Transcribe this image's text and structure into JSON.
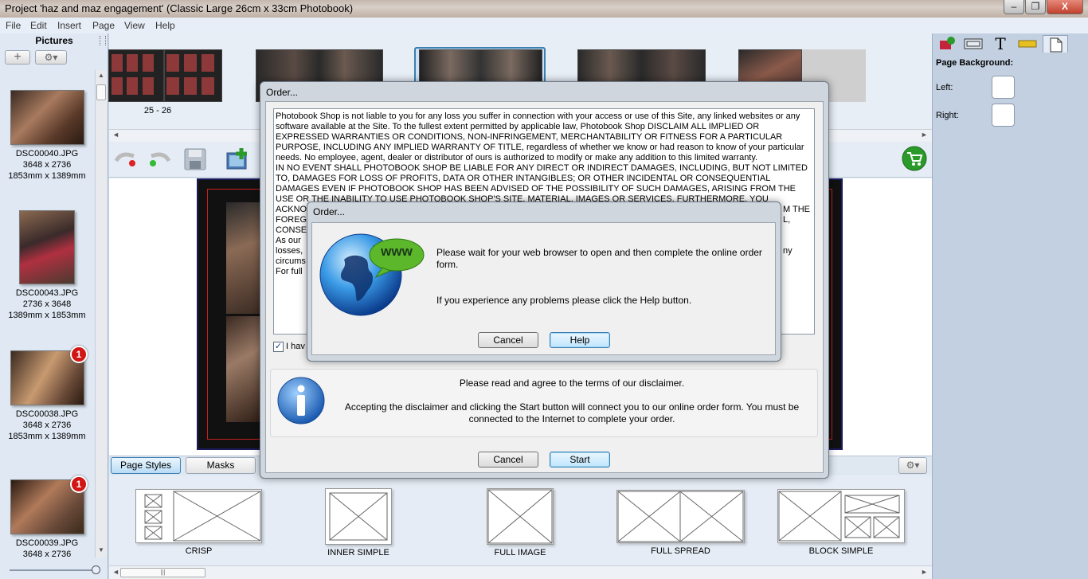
{
  "window": {
    "title": "Project 'haz and maz engagement' (Classic Large 26cm x 33cm Photobook)",
    "minimize": "–",
    "maximize": "❐",
    "close": "X"
  },
  "menu": [
    "File",
    "Edit",
    "Insert",
    "Page",
    "View",
    "Help"
  ],
  "left_panel": {
    "heading": "Pictures",
    "add_icon": "+",
    "gear_icon": "⚙▾",
    "pictures": [
      {
        "name": "DSC00040.JPG",
        "pixels": "3648 x 2736",
        "size": "1853mm x 1389mm",
        "badge": ""
      },
      {
        "name": "DSC00043.JPG",
        "pixels": "2736 x 3648",
        "size": "1389mm x 1853mm",
        "badge": ""
      },
      {
        "name": "DSC00038.JPG",
        "pixels": "3648 x 2736",
        "size": "1853mm x 1389mm",
        "badge": "1"
      },
      {
        "name": "DSC00039.JPG",
        "pixels": "3648 x 2736",
        "size": "",
        "badge": "1"
      }
    ]
  },
  "filmstrip": {
    "page_range_label": "25 - 26"
  },
  "toolbar": {
    "undo_icon": "undo-icon",
    "redo_icon": "redo-icon",
    "save_icon": "save-icon",
    "add_page_icon": "add-page-icon",
    "cart_icon": "cart-icon"
  },
  "bottom_tabs": {
    "page_styles": "Page Styles",
    "masks": "Masks"
  },
  "layouts": [
    "CRISP",
    "INNER SIMPLE",
    "FULL IMAGE",
    "FULL SPREAD",
    "BLOCK SIMPLE"
  ],
  "right_panel": {
    "page_background": "Page Background:",
    "left": "Left:",
    "right": "Right:",
    "text_tab": "T"
  },
  "order_dialog": {
    "title": "Order...",
    "disclaimer": "Photobook Shop is not liable to you for any loss you suffer in connection with your access or use of this Site, any linked websites or any software available at the Site. To the fullest extent permitted by applicable law, Photobook Shop DISCLAIM ALL IMPLIED OR EXPRESSED WARRANTIES OR CONDITIONS, NON-INFRINGEMENT, MERCHANTABILITY OR FITNESS FOR A PARTICULAR PURPOSE, INCLUDING ANY IMPLIED WARRANTY OF TITLE, regardless of whether we know or had reason to know of your particular needs. No employee, agent, dealer or distributor of ours is authorized to modify or make any addition to this limited warranty.\nIN NO EVENT SHALL PHOTOBOOK SHOP BE LIABLE FOR ANY DIRECT OR INDIRECT DAMAGES, INCLUDING, BUT NOT LIMITED TO, DAMAGES FOR LOSS OF PROFITS, DATA OR OTHER INTANGIBLES; OR OTHER INCIDENTAL OR CONSEQUENTIAL DAMAGES EVEN IF PHOTOBOOK SHOP HAS BEEN ADVISED OF THE POSSIBILITY OF SUCH DAMAGES, ARISING FROM THE USE OR THE INABILITY TO USE PHOTOBOOK SHOP'S SITE, MATERIAL, IMAGES OR SERVICES. FURTHERMORE, YOU ACKNOWLEDGE THAT PHOTOBOOK SHOP IS NOT LIABLE",
    "fragments": [
      "FOREG",
      "CONSEC",
      "As our",
      "losses,",
      "circums",
      "For full"
    ],
    "right_fragments": [
      "M THE",
      "L,",
      "ny"
    ],
    "agree_checkbox_label": "I hav",
    "info_heading": "Please read and agree to the terms of our disclaimer.",
    "info_body": "Accepting the disclaimer and clicking the Start button will connect you to our online order form. You must be connected to the Internet to complete your order.",
    "cancel": "Cancel",
    "start": "Start"
  },
  "wait_dialog": {
    "title": "Order...",
    "www": "www",
    "message": "Please wait for your web browser to open and then complete the online order form.",
    "help_message": "If you experience any problems please click the Help button.",
    "cancel": "Cancel",
    "help": "Help"
  },
  "colors": {
    "accent": "#3c7fb1",
    "badge": "#d21515",
    "cart": "#2a9a2a"
  }
}
